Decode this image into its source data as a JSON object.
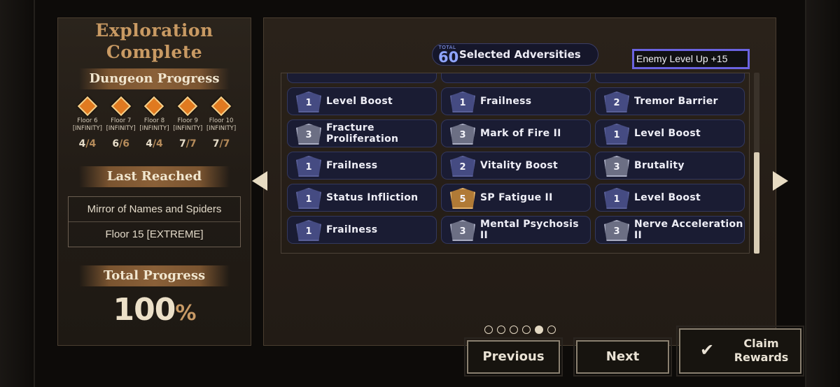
{
  "left": {
    "title_line1": "Exploration",
    "title_line2": "Complete",
    "dungeon_progress_label": "Dungeon Progress",
    "floors": [
      {
        "name": "Floor 6",
        "difficulty": "[INFINITY]",
        "done": "4",
        "total": "/4"
      },
      {
        "name": "Floor 7",
        "difficulty": "[INFINITY]",
        "done": "6",
        "total": "/6"
      },
      {
        "name": "Floor 8",
        "difficulty": "[INFINITY]",
        "done": "4",
        "total": "/4"
      },
      {
        "name": "Floor 9",
        "difficulty": "[INFINITY]",
        "done": "7",
        "total": "/7"
      },
      {
        "name": "Floor 10",
        "difficulty": "[INFINITY]",
        "done": "7",
        "total": "/7"
      }
    ],
    "last_reached_label": "Last Reached",
    "last_reached_dungeon": "Mirror of Names and Spiders",
    "last_reached_floor": "Floor 15 [EXTREME]",
    "total_progress_label": "Total Progress",
    "total_progress_value": "100",
    "total_progress_unit": "%"
  },
  "right": {
    "total_label": "TOTAL",
    "total_count": "60",
    "selected_label": "Selected Adversities",
    "enemy_level_tag": "Enemy Level Up +15",
    "adversity_rows": [
      [
        {
          "level": "1",
          "name": "Level Boost",
          "tier": "blue"
        },
        {
          "level": "1",
          "name": "Frailness",
          "tier": "blue"
        },
        {
          "level": "2",
          "name": "Tremor Barrier",
          "tier": "blue"
        }
      ],
      [
        {
          "level": "3",
          "name": "Fracture Proliferation",
          "tier": "grey"
        },
        {
          "level": "3",
          "name": "Mark of Fire II",
          "tier": "grey"
        },
        {
          "level": "1",
          "name": "Level Boost",
          "tier": "blue"
        }
      ],
      [
        {
          "level": "1",
          "name": "Frailness",
          "tier": "blue"
        },
        {
          "level": "2",
          "name": "Vitality Boost",
          "tier": "blue"
        },
        {
          "level": "3",
          "name": "Brutality",
          "tier": "grey"
        }
      ],
      [
        {
          "level": "1",
          "name": "Status Infliction",
          "tier": "blue"
        },
        {
          "level": "5",
          "name": "SP Fatigue II",
          "tier": "gold"
        },
        {
          "level": "1",
          "name": "Level Boost",
          "tier": "blue"
        }
      ],
      [
        {
          "level": "1",
          "name": "Frailness",
          "tier": "blue"
        },
        {
          "level": "3",
          "name": "Mental Psychosis II",
          "tier": "grey"
        },
        {
          "level": "3",
          "name": "Nerve Acceleration II",
          "tier": "grey"
        }
      ]
    ],
    "scroll_fraction": 0.55
  },
  "pagination": {
    "total_pages": 6,
    "active_page": 5
  },
  "buttons": {
    "previous": "Previous",
    "next": "Next",
    "claim_line1": "Claim",
    "claim_line2": "Rewards"
  },
  "icons": {
    "claim_icon": "check-icon",
    "prev_arrow": "arrow-left-icon",
    "next_arrow": "arrow-right-icon",
    "floor_marker": "diamond-floor-icon"
  }
}
